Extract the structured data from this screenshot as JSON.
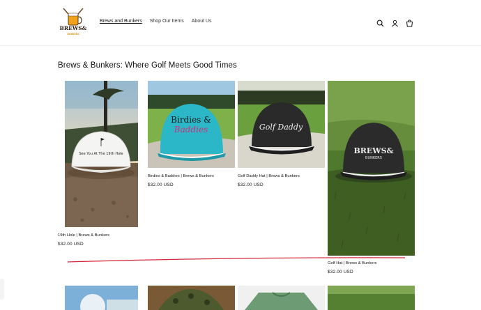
{
  "header": {
    "logo_alt_top": "BREWS&",
    "logo_alt_bottom": "BUNKERS",
    "nav": [
      {
        "label": "Brews and Bunkers",
        "active": true
      },
      {
        "label": "Shop Our Items",
        "active": false
      },
      {
        "label": "About Us",
        "active": false
      }
    ],
    "icons": [
      "search-icon",
      "account-icon",
      "cart-icon"
    ]
  },
  "main": {
    "heading": "Brews & Bunkers: Where Golf Meets Good Times",
    "products": [
      {
        "title": "19th Hole | Brews & Bunkers",
        "price": "$32.00 USD",
        "cap_text": "See You At The 19th Hole"
      },
      {
        "title": "Birdies & Baddies | Brews & Bunkers",
        "price": "$32.00 USD",
        "cap_text_1": "Birdies &",
        "cap_text_2": "Baddies"
      },
      {
        "title": "Golf Daddy Hat | Brews & Bunkers",
        "price": "$32.00 USD",
        "cap_text": "Golf Daddy"
      },
      {
        "title": "Golf Hat | Brews & Bunkers",
        "price": "$32.00 USD",
        "cap_text_1": "BREWS&",
        "cap_text_2": "BUNKERS"
      }
    ]
  },
  "colors": {
    "accent_line": "#d6263b",
    "cap_teal": "#29b6c6",
    "text": "#121212"
  }
}
